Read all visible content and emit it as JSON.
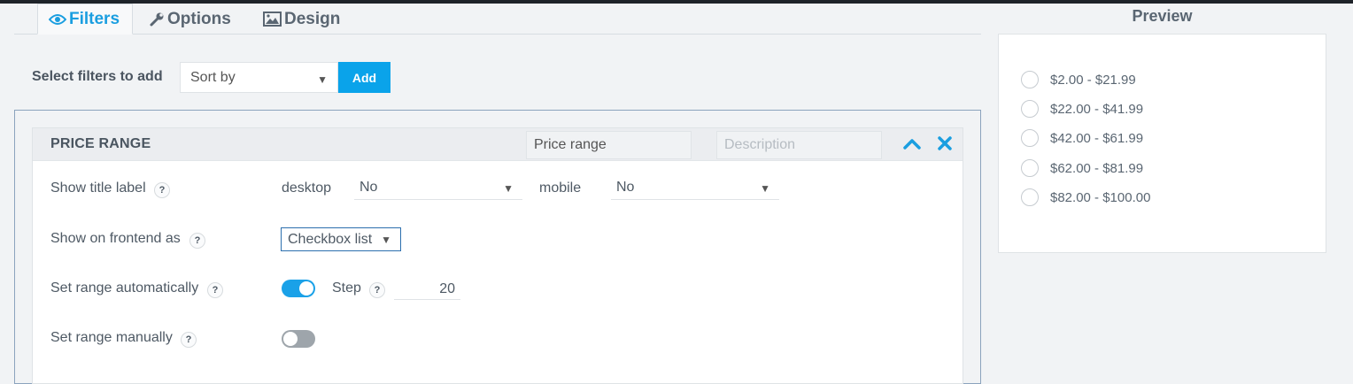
{
  "tabs": [
    {
      "label": "Filters",
      "icon": "eye-icon",
      "active": true
    },
    {
      "label": "Options",
      "icon": "wrench-icon",
      "active": false
    },
    {
      "label": "Design",
      "icon": "image-icon",
      "active": false
    }
  ],
  "add_filter": {
    "label": "Select filters to add",
    "select_value": "Sort by",
    "add_button": "Add"
  },
  "filter": {
    "title": "PRICE RANGE",
    "name_value": "Price range",
    "description_placeholder": "Description",
    "rows": {
      "show_title": {
        "label": "Show title label",
        "desktop_label": "desktop",
        "desktop_value": "No",
        "mobile_label": "mobile",
        "mobile_value": "No"
      },
      "show_frontend": {
        "label": "Show on frontend as",
        "value": "Checkbox list"
      },
      "auto_range": {
        "label": "Set range automatically",
        "enabled": true,
        "step_label": "Step",
        "step_value": "20"
      },
      "manual_range": {
        "label": "Set range manually",
        "enabled": false
      }
    },
    "help_glyph": "?"
  },
  "preview": {
    "title": "Preview",
    "options": [
      "$2.00 - $21.99",
      "$22.00 - $41.99",
      "$42.00 - $61.99",
      "$62.00 - $81.99",
      "$82.00 - $100.00"
    ]
  },
  "colors": {
    "accent": "#0aa3ea",
    "toggle_on": "#1aa1e8",
    "toggle_off": "#9ea5ab",
    "topbar": "#1e2329"
  }
}
